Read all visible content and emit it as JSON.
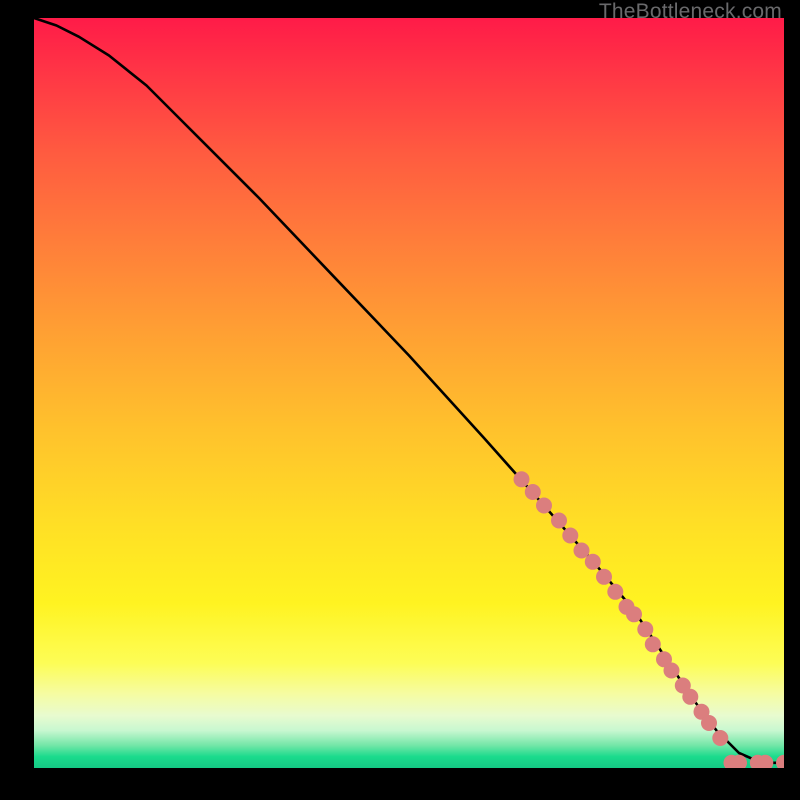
{
  "watermark": "TheBottleneck.com",
  "chart_data": {
    "type": "line",
    "title": "",
    "xlabel": "",
    "ylabel": "",
    "xlim": [
      0,
      100
    ],
    "ylim": [
      0,
      100
    ],
    "grid": false,
    "legend": false,
    "series": [
      {
        "name": "curve",
        "color": "#000000",
        "x": [
          0,
          3,
          6,
          10,
          15,
          20,
          30,
          40,
          50,
          60,
          68,
          75,
          80,
          84,
          88,
          91,
          94,
          97,
          100
        ],
        "y": [
          100,
          99,
          97.5,
          95,
          91,
          86,
          76,
          65.5,
          55,
          44,
          35,
          27,
          21,
          15,
          9,
          5,
          2,
          0.7,
          0.7
        ]
      }
    ],
    "markers": [
      {
        "name": "dots",
        "color": "#db7e7e",
        "radius_px": 8,
        "points": [
          {
            "x": 65.0,
            "y": 38.5
          },
          {
            "x": 66.5,
            "y": 36.8
          },
          {
            "x": 68.0,
            "y": 35.0
          },
          {
            "x": 70.0,
            "y": 33.0
          },
          {
            "x": 71.5,
            "y": 31.0
          },
          {
            "x": 73.0,
            "y": 29.0
          },
          {
            "x": 74.5,
            "y": 27.5
          },
          {
            "x": 76.0,
            "y": 25.5
          },
          {
            "x": 77.5,
            "y": 23.5
          },
          {
            "x": 79.0,
            "y": 21.5
          },
          {
            "x": 80.0,
            "y": 20.5
          },
          {
            "x": 81.5,
            "y": 18.5
          },
          {
            "x": 82.5,
            "y": 16.5
          },
          {
            "x": 84.0,
            "y": 14.5
          },
          {
            "x": 85.0,
            "y": 13.0
          },
          {
            "x": 86.5,
            "y": 11.0
          },
          {
            "x": 87.5,
            "y": 9.5
          },
          {
            "x": 89.0,
            "y": 7.5
          },
          {
            "x": 90.0,
            "y": 6.0
          },
          {
            "x": 91.5,
            "y": 4.0
          },
          {
            "x": 93.0,
            "y": 0.7
          },
          {
            "x": 94.0,
            "y": 0.7
          },
          {
            "x": 96.5,
            "y": 0.7
          },
          {
            "x": 97.5,
            "y": 0.7
          },
          {
            "x": 100.0,
            "y": 0.7
          }
        ]
      }
    ]
  }
}
